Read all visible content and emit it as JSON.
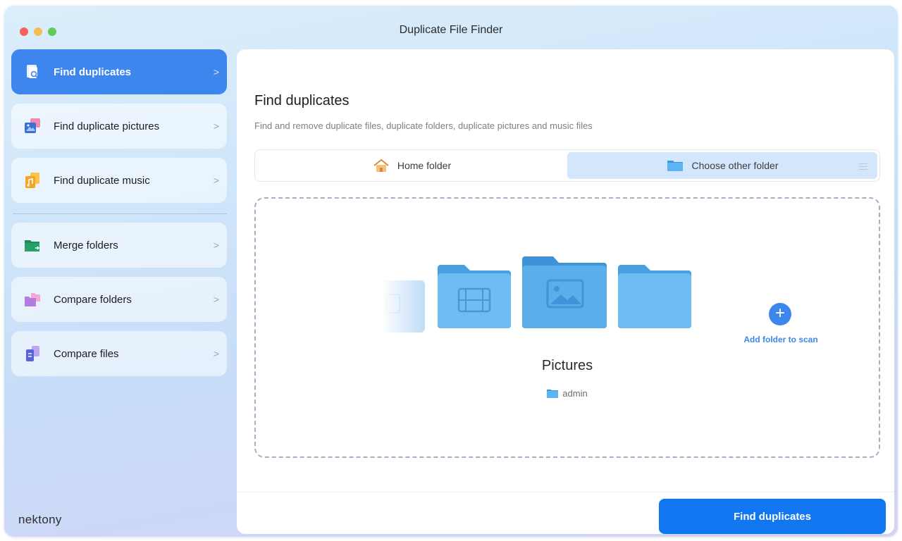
{
  "window": {
    "title": "Duplicate File Finder"
  },
  "sidebar": {
    "items": [
      {
        "label": "Find duplicates",
        "icon": "find-duplicates-icon",
        "active": true
      },
      {
        "label": "Find duplicate pictures",
        "icon": "duplicate-pictures-icon",
        "active": false
      },
      {
        "label": "Find duplicate music",
        "icon": "duplicate-music-icon",
        "active": false
      },
      {
        "label": "Merge folders",
        "icon": "merge-folders-icon",
        "active": false
      },
      {
        "label": "Compare folders",
        "icon": "compare-folders-icon",
        "active": false
      },
      {
        "label": "Compare files",
        "icon": "compare-files-icon",
        "active": false
      }
    ],
    "chevron": ">",
    "brand": "nektony"
  },
  "main": {
    "title": "Find duplicates",
    "subtitle": "Find and remove duplicate files, duplicate folders, duplicate pictures and music files",
    "tabs": {
      "home": "Home folder",
      "other": "Choose other folder"
    },
    "dropzone": {
      "folder_name": "Pictures",
      "folder_path": "admin",
      "add_label": "Add folder to scan",
      "add_symbol": "+"
    },
    "primary_button": "Find duplicates"
  },
  "colors": {
    "accent": "#1177f0",
    "sidebar_active": "#3e86ee",
    "folder_blue": "#5aaeea"
  }
}
